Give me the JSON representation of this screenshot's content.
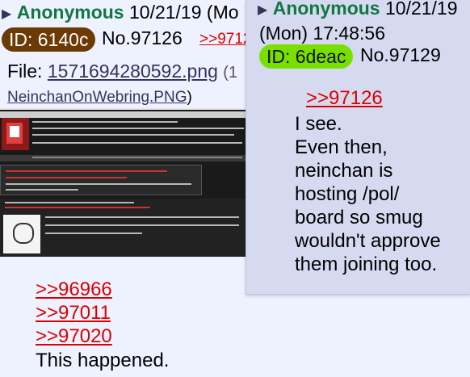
{
  "post_a": {
    "name": "Anonymous",
    "date": "10/21/19 (Mo",
    "id_label": "ID: 6140c",
    "id_color": "#6b3a05",
    "number": "No.97126",
    "partial_link": ">>9712",
    "file_label": "File:",
    "file_name": "1571694280592.png",
    "file_extra": "(1",
    "file_orig": "NeinchanOnWebring.PNG",
    "file_orig_paren": ")",
    "quotes": [
      ">>96966",
      ">>97011",
      ">>97020"
    ],
    "body": "This happened."
  },
  "post_b": {
    "name": "Anonymous",
    "date_line1": "10/21/19",
    "date_line2": "(Mon) 17:48:56",
    "id_label": "ID: 6deac",
    "id_color": "#78e000",
    "number": "No.97129",
    "quote": ">>97126",
    "body_lines": [
      "I see.",
      "Even then,",
      "neinchan is",
      "hosting /pol/",
      "board so smug",
      "wouldn't approve",
      "them joining too."
    ]
  },
  "colors": {
    "background": "#eef2ff",
    "name_green": "#117743",
    "link_red": "#dd0000",
    "link_navy": "#34345c",
    "reply_bg": "#d6daf0"
  },
  "icons": [
    "post-menu-arrow-icon"
  ]
}
